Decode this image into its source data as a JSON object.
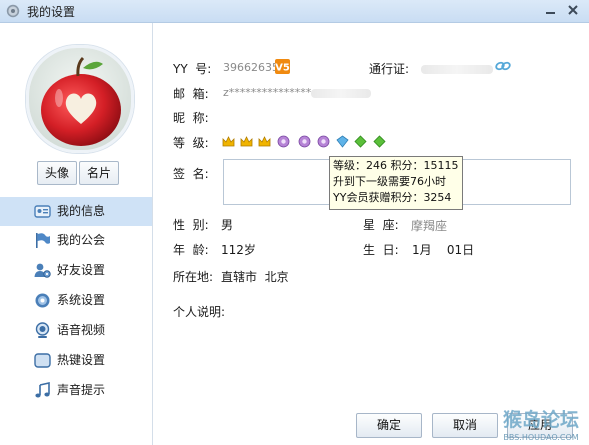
{
  "window": {
    "title": "我的设置"
  },
  "profile": {
    "avatar_button": "头像",
    "card_button": "名片"
  },
  "sidebar": {
    "items": [
      {
        "label": "我的信息",
        "active": true
      },
      {
        "label": "我的公会"
      },
      {
        "label": "好友设置"
      },
      {
        "label": "系统设置"
      },
      {
        "label": "语音视频"
      },
      {
        "label": "热键设置"
      },
      {
        "label": "声音提示"
      }
    ]
  },
  "info": {
    "yy_label": "YY  号:",
    "yy_value": "39662635",
    "yy_badge": "V5",
    "pass_label": "通行证:",
    "email_label": "邮  箱:",
    "email_value": "z***************",
    "nick_label": "昵  称:",
    "level_label": "等  级:",
    "sign_label": "签  名:",
    "gender_label": "性  别:",
    "gender_value": "男",
    "zodiac_label": "星  座:",
    "zodiac_value": "摩羯座",
    "age_label": "年  龄:",
    "age_value": "112岁",
    "birthday_label": "生  日:",
    "birthday_value": "1月    01日",
    "location_label": "所在地:",
    "location_value": "直辖市  北京",
    "about_label": "个人说明:"
  },
  "tooltip": {
    "line1": "等级：246  积分：15115",
    "line2": "升到下一级需要76小时",
    "line3": "YY会员获赠积分：3254"
  },
  "buttons": {
    "ok": "确定",
    "cancel": "取消",
    "apply": "应用"
  },
  "watermark": {
    "text": "猴岛论坛",
    "url": "BBS.HOUDAO.COM"
  },
  "colors": {
    "selection": "#cfe2f6",
    "titlebar": "#c9ddf3",
    "crown": "#f0b400",
    "gem_purple": "#b684d6",
    "gem_blue": "#5fb3e8",
    "gem_green": "#5bbf3a",
    "yy_badge": "#f08a10"
  },
  "icons": {
    "title": "gear-icon",
    "pass": "link-icon",
    "nav": [
      "id-card-icon",
      "flag-icon",
      "user-settings-icon",
      "gear-icon",
      "webcam-icon",
      "keyboard-icon",
      "music-note-icon"
    ]
  }
}
